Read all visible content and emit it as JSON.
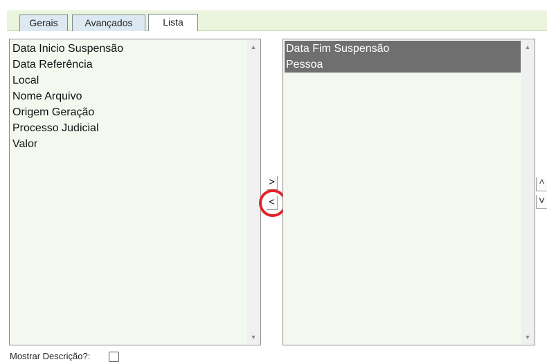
{
  "tabs": [
    {
      "label": "Gerais"
    },
    {
      "label": "Avançados"
    },
    {
      "label": "Lista"
    }
  ],
  "available_list": {
    "items": [
      "Data Inicio Suspensão",
      "Data Referência",
      "Local",
      "Nome Arquivo",
      "Origem Geração",
      "Processo Judicial",
      "Valor"
    ]
  },
  "selected_list": {
    "items": [
      "Data Fim Suspensão",
      "Pessoa"
    ]
  },
  "transfer": {
    "add_label": ">",
    "remove_label": "<"
  },
  "order": {
    "up_label": "^",
    "down_label": "v"
  },
  "scroll": {
    "up_glyph": "▲",
    "down_glyph": "▼"
  },
  "footer": {
    "show_description_label": "Mostrar Descrição?:",
    "show_description_checked": false
  },
  "colors": {
    "highlight_ring": "#e3232b",
    "selected_row": "#6f6f6f",
    "tab_band": "#ebf4dc"
  }
}
